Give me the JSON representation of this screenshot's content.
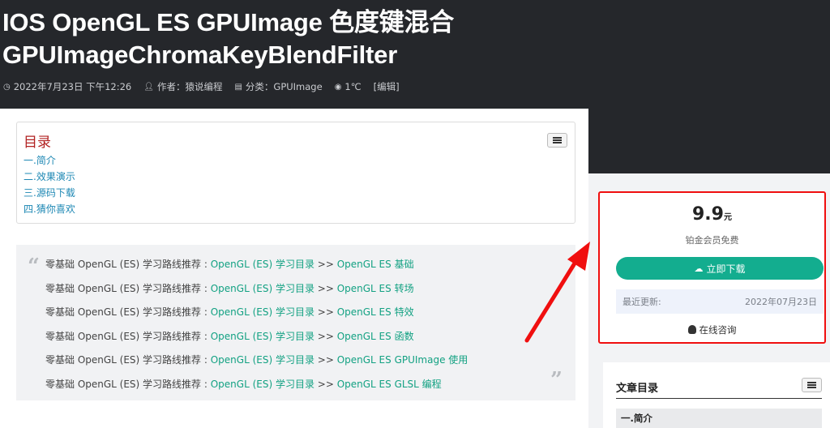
{
  "article": {
    "title_line1": "IOS OpenGL ES GPUImage 色度键混合",
    "title_line2": "GPUImageChromaKeyBlendFilter",
    "meta": {
      "date": "2022年7月23日 下午12:26",
      "author": "作者：猿说编程",
      "category": "分类：GPUImage",
      "views": "1℃",
      "edit": "[编辑]"
    }
  },
  "toc": {
    "title": "目录",
    "items": [
      "一.简介",
      "二.效果演示",
      "三.源码下载",
      "四.猜你喜欢"
    ]
  },
  "quote": {
    "open_mark": "“",
    "close_mark": "”",
    "lines": [
      {
        "prefix": "零基础 OpenGL (ES) 学习路线推荐 : ",
        "link1": "OpenGL (ES) 学习目录",
        "sep": " >> ",
        "link2": "OpenGL ES 基础"
      },
      {
        "prefix": "零基础 OpenGL (ES) 学习路线推荐 : ",
        "link1": "OpenGL (ES) 学习目录",
        "sep": " >> ",
        "link2": "OpenGL ES 转场"
      },
      {
        "prefix": "零基础 OpenGL (ES) 学习路线推荐 : ",
        "link1": "OpenGL (ES) 学习目录",
        "sep": " >> ",
        "link2": "OpenGL ES 特效"
      },
      {
        "prefix": "零基础 OpenGL (ES) 学习路线推荐 : ",
        "link1": "OpenGL (ES) 学习目录",
        "sep": " >> ",
        "link2": "OpenGL ES 函数"
      },
      {
        "prefix": "零基础 OpenGL (ES) 学习路线推荐 : ",
        "link1": "OpenGL (ES) 学习目录",
        "sep": " >> ",
        "link2": "OpenGL ES GPUImage 使用"
      },
      {
        "prefix": "零基础 OpenGL (ES) 学习路线推荐 : ",
        "link1": "OpenGL (ES) 学习目录",
        "sep": " >> ",
        "link2": "OpenGL ES GLSL 编程"
      }
    ]
  },
  "download_card": {
    "price": "9.9",
    "unit": "元",
    "free_note": "铂金会员免费",
    "button_label": "立即下载",
    "update_label": "最近更新:",
    "update_date": "2022年07月23日",
    "consult_label": "在线咨询"
  },
  "sidebar_toc": {
    "title": "文章目录",
    "first_item": "一.简介"
  },
  "icons": [
    "clock-icon",
    "user-icon",
    "category-icon",
    "eye-icon",
    "list-toggle-icon",
    "cloud-download-icon",
    "qq-icon",
    "red-arrow-annotation"
  ],
  "colors": {
    "hero_bg": "#25272b",
    "link_green": "#12a182",
    "toc_title_red": "#b22222",
    "button_green": "#13ad8f",
    "highlight_red": "#f00f0f"
  }
}
